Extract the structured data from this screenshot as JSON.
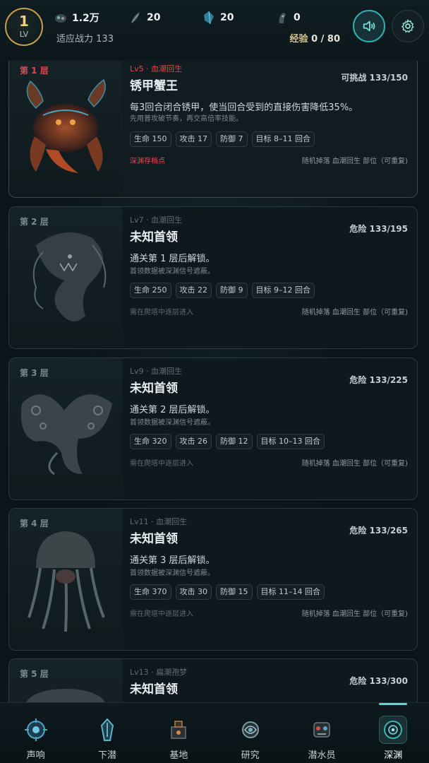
{
  "header": {
    "level_num": "1",
    "level_label": "LV",
    "resources": [
      {
        "icon": "coral-ore-icon",
        "value": "1.2万"
      },
      {
        "icon": "feather-icon",
        "value": "20"
      },
      {
        "icon": "crystal-shard-icon",
        "value": "20"
      },
      {
        "icon": "fossil-icon",
        "value": "0"
      }
    ],
    "power_label": "适应战力",
    "power_value": "133",
    "exp_label": "经验",
    "exp_value": "0 / 80",
    "sound_icon": "speaker-icon",
    "settings_icon": "gear-icon"
  },
  "floors": [
    {
      "floor": "第 1 层",
      "lvl": "Lv5 · 血潮回生",
      "name": "锈甲蟹王",
      "status": "可挑战 133/150",
      "desc": "每3回合闭合锈甲，使当回合受到的直接伤害降低35%。",
      "sub": "先用普攻破节奏，再交高倍率技能。",
      "tags": [
        "生命 150",
        "攻击 17",
        "防御 7",
        "目标 8–11 回合"
      ],
      "hint": "深渊存档点",
      "drop": "随机掉落 血潮回生 部位（可重复)"
    },
    {
      "floor": "第 2 层",
      "lvl": "Lv7 · 血潮回生",
      "name": "未知首领",
      "status": "危险 133/195",
      "desc": "通关第 1 层后解锁。",
      "sub": "首领数据被深渊信号遮蔽。",
      "tags": [
        "生命 250",
        "攻击 22",
        "防御 9",
        "目标 9–12 回合"
      ],
      "hint": "需在爬塔中逐层进入",
      "drop": "随机掉落 血潮回生 部位（可重复)"
    },
    {
      "floor": "第 3 层",
      "lvl": "Lv9 · 血潮回生",
      "name": "未知首领",
      "status": "危险 133/225",
      "desc": "通关第 2 层后解锁。",
      "sub": "首领数据被深渊信号遮蔽。",
      "tags": [
        "生命 320",
        "攻击 26",
        "防御 12",
        "目标 10–13 回合"
      ],
      "hint": "需在爬塔中逐层进入",
      "drop": "随机掉落 血潮回生 部位（可重复)"
    },
    {
      "floor": "第 4 层",
      "lvl": "Lv11 · 血潮回生",
      "name": "未知首领",
      "status": "危险 133/265",
      "desc": "通关第 3 层后解锁。",
      "sub": "首领数据被深渊信号遮蔽。",
      "tags": [
        "生命 370",
        "攻击 30",
        "防御 15",
        "目标 11–14 回合"
      ],
      "hint": "需在爬塔中逐层进入",
      "drop": "随机掉落 血潮回生 部位（可重复)"
    },
    {
      "floor": "第 5 层",
      "lvl": "Lv13 · 扁潮孢梦",
      "name": "未知首领",
      "status": "危险 133/300",
      "desc": "",
      "sub": "",
      "tags": [],
      "hint": "",
      "drop": ""
    }
  ],
  "nav": [
    {
      "label": "声响",
      "icon": "sonar-icon",
      "active": false
    },
    {
      "label": "下潜",
      "icon": "dive-icon",
      "active": false
    },
    {
      "label": "基地",
      "icon": "base-icon",
      "active": false
    },
    {
      "label": "研究",
      "icon": "research-icon",
      "active": false
    },
    {
      "label": "潜水员",
      "icon": "diver-icon",
      "active": false
    },
    {
      "label": "深渊",
      "icon": "abyss-icon",
      "active": true
    }
  ],
  "colors": {
    "accent": "#5fd6cf",
    "danger": "#e0484c",
    "gold": "#c7a04a"
  }
}
